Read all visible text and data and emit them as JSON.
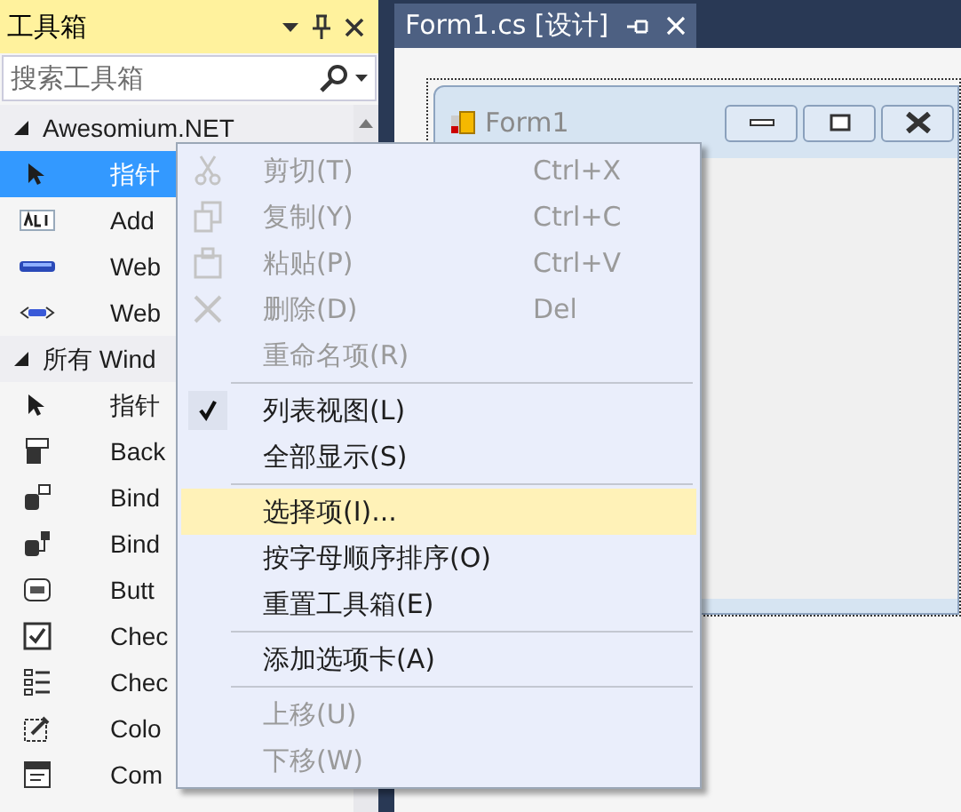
{
  "toolbox": {
    "title": "工具箱",
    "search": {
      "placeholder": "搜索工具箱"
    },
    "groups": [
      {
        "label": "Awesomium.NET",
        "expanded": true,
        "items": [
          {
            "label": "指针",
            "selected": true
          },
          {
            "label": "Add",
            "selected": false
          },
          {
            "label": "Web",
            "selected": false
          },
          {
            "label": "Web",
            "selected": false
          }
        ]
      },
      {
        "label": "所有 Wind",
        "expanded": true,
        "items": [
          {
            "label": "指针",
            "selected": false
          },
          {
            "label": "Back",
            "selected": false
          },
          {
            "label": "Bind",
            "selected": false
          },
          {
            "label": "Bind",
            "selected": false
          },
          {
            "label": "Butt",
            "selected": false
          },
          {
            "label": "Chec",
            "selected": false
          },
          {
            "label": "Chec",
            "selected": false
          },
          {
            "label": "Colo",
            "selected": false
          },
          {
            "label": "Com",
            "selected": false
          }
        ]
      }
    ]
  },
  "designer": {
    "tab": {
      "label": "Form1.cs [设计]",
      "selected": true
    },
    "form": {
      "title": "Form1"
    }
  },
  "context_menu": [
    {
      "kind": "item",
      "label": "剪切(T)",
      "shortcut": "Ctrl+X",
      "disabled": true,
      "checked": false,
      "selected": false
    },
    {
      "kind": "item",
      "label": "复制(Y)",
      "shortcut": "Ctrl+C",
      "disabled": true,
      "checked": false,
      "selected": false
    },
    {
      "kind": "item",
      "label": "粘贴(P)",
      "shortcut": "Ctrl+V",
      "disabled": true,
      "checked": false,
      "selected": false
    },
    {
      "kind": "item",
      "label": "删除(D)",
      "shortcut": "Del",
      "disabled": true,
      "checked": false,
      "selected": false
    },
    {
      "kind": "item",
      "label": "重命名项(R)",
      "disabled": true,
      "checked": false,
      "selected": false
    },
    {
      "kind": "separator"
    },
    {
      "kind": "item",
      "label": "列表视图(L)",
      "disabled": false,
      "checked": true,
      "selected": false
    },
    {
      "kind": "item",
      "label": "全部显示(S)",
      "disabled": false,
      "checked": false,
      "selected": false
    },
    {
      "kind": "separator"
    },
    {
      "kind": "item",
      "label": "选择项(I)...",
      "disabled": false,
      "checked": false,
      "selected": true
    },
    {
      "kind": "item",
      "label": "按字母顺序排序(O)",
      "disabled": false,
      "checked": false,
      "selected": false
    },
    {
      "kind": "item",
      "label": "重置工具箱(E)",
      "disabled": false,
      "checked": false,
      "selected": false
    },
    {
      "kind": "separator"
    },
    {
      "kind": "item",
      "label": "添加选项卡(A)",
      "disabled": false,
      "checked": false,
      "selected": false
    },
    {
      "kind": "separator"
    },
    {
      "kind": "item",
      "label": "上移(U)",
      "disabled": true,
      "checked": false,
      "selected": false
    },
    {
      "kind": "item",
      "label": "下移(W)",
      "disabled": true,
      "checked": false,
      "selected": false
    }
  ]
}
